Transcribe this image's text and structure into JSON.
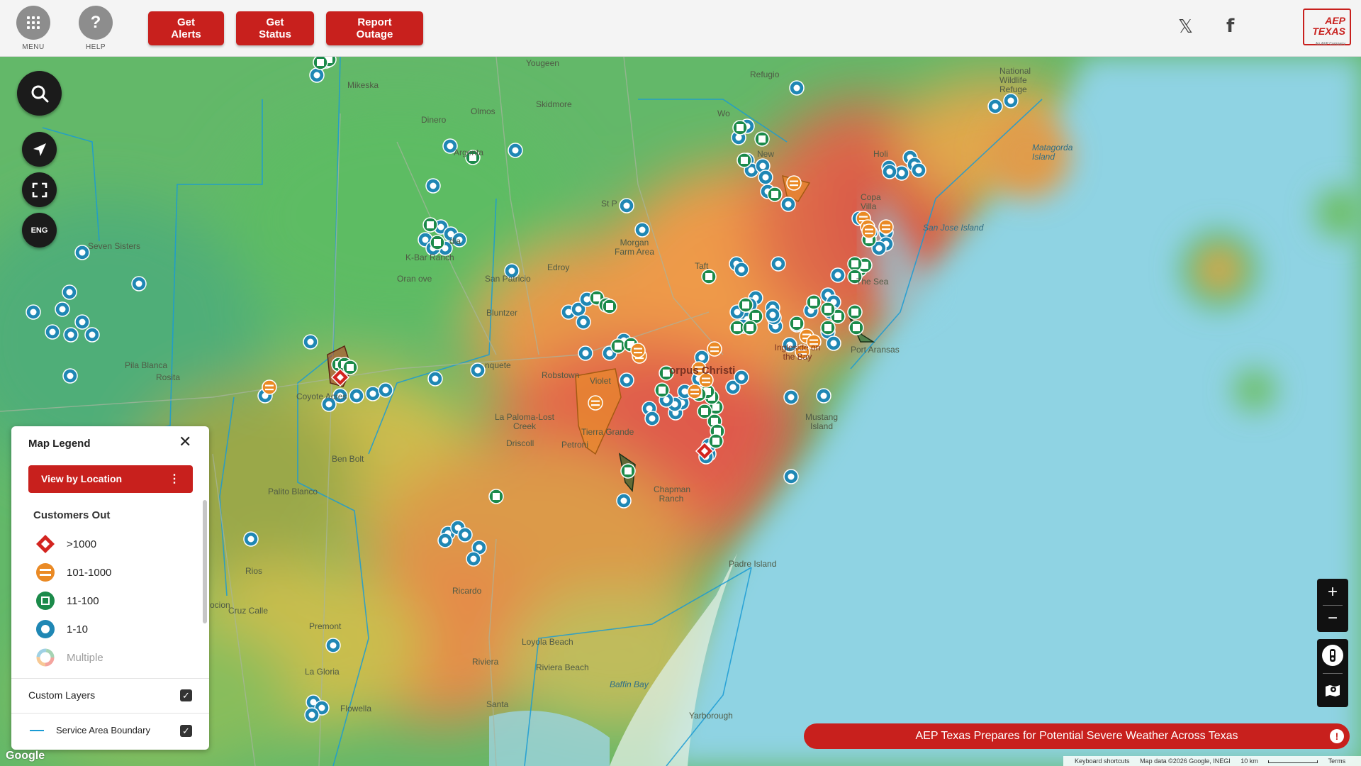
{
  "header": {
    "menu_label": "MENU",
    "help_label": "HELP",
    "help_icon_glyph": "?",
    "get_alerts": "Get Alerts",
    "get_status": "Get Status",
    "report_outage": "Report Outage",
    "social_x_glyph": "𝕏",
    "social_facebook_glyph": "f",
    "logo_text_1": "AEP",
    "logo_text_2": "TEXAS",
    "logo_subtext": "An AEP Company"
  },
  "map_tools": {
    "language_label": "ENG"
  },
  "places": {
    "youngeen": "Yougeen",
    "refugio": "Refugio",
    "mikeska": "Mikeska",
    "olmos": "Olmos",
    "skidmore": "Skidmore",
    "dinero": "Dinero",
    "woodsboro": "Wo",
    "argenta": "Argenta",
    "bonnie_view": "New",
    "seven_sisters": "Seven Sisters",
    "st_paul": "St P",
    "morgan_farm": "Morgan Farm Area",
    "holiday_beach": "Holi",
    "matagorda_island": "Matagorda Island",
    "san_jose_island": "San Jose Island",
    "national_wildlife": "National Wildlife Refuge",
    "kbar_ranch": "K-Bar Ranch",
    "orange_grove": "Oran     ove",
    "sandia": "dia",
    "san_patricio": "San Patricio",
    "edroy": "Edroy",
    "taft": "Taft",
    "copano": "Copa Villa",
    "by_the_sea": "-The Sea",
    "pila_blanca": "Pila Blanca",
    "rosita": "Rosita",
    "bluntzer": "Bluntzer",
    "banquete": "nquete",
    "robstown": "Robstown",
    "violet": "Violet",
    "corpus_christi": "orpus Christi",
    "ingleside": "Ingleside on the Bay",
    "port_aransas": "Port Aransas",
    "coyote_acres": "Coyote Acres",
    "la_paloma": "La Paloma-Lost Creek",
    "driscoll": "Driscoll",
    "petronila": "Petroni",
    "tierra_grande": "Tierra Grande",
    "mustang_island": "Mustang Island",
    "ben_bolt": "Ben Bolt",
    "palito_blanco": "Palito Blanco",
    "chapman_ranch": "Chapman Ranch",
    "rios": "Rios",
    "padre_island": "Padre Island",
    "ricardo": "Ricardo",
    "cruz_calle": "Cruz Calle",
    "premont": "Premont",
    "loyola_beach": "Loyola Beach",
    "la_gloria": "La Gloria",
    "riviera": "Riviera",
    "riviera_beach": "Riviera Beach",
    "baffin_bay": "Baffin Bay",
    "flowella": "Flowella",
    "santa": "Santa",
    "yarborough": "Yarborough",
    "ocion": "ocion"
  },
  "legend": {
    "title": "Map Legend",
    "close_glyph": "✕",
    "view_by_location": "View by Location",
    "menu_dots": "⋮",
    "section_customers_out": "Customers Out",
    "items": [
      {
        "label": ">1000",
        "icon": "red-diamond-icon",
        "color": "#d3241f"
      },
      {
        "label": "101-1000",
        "icon": "orange-stripes-icon",
        "color": "#ea8a25"
      },
      {
        "label": "11-100",
        "icon": "green-square-icon",
        "color": "#1b8a4a"
      },
      {
        "label": "1-10",
        "icon": "blue-ring-icon",
        "color": "#1f87b4"
      },
      {
        "label": "Multiple",
        "icon": "multi-ring-icon",
        "color": "#aaaaaa"
      }
    ],
    "custom_layers": "Custom Layers",
    "service_area_boundary": "Service Area Boundary",
    "check_glyph": "✓"
  },
  "zoom": {
    "plus": "+",
    "minus": "−"
  },
  "banner": {
    "text": "AEP Texas Prepares for Potential Severe Weather Across Texas",
    "alert_glyph": "!"
  },
  "attribution": {
    "keyboard": "Keyboard shortcuts",
    "map_data": "Map data ©2026 Google, INEGI",
    "scale": "10 km",
    "terms": "Terms",
    "google": "Google"
  },
  "colors": {
    "brand_red": "#c8201d",
    "outage_red": "#d3241f",
    "outage_orange": "#ea8a25",
    "outage_green": "#1b8a4a",
    "outage_blue": "#1f87b4",
    "water": "#8fd3e3"
  }
}
